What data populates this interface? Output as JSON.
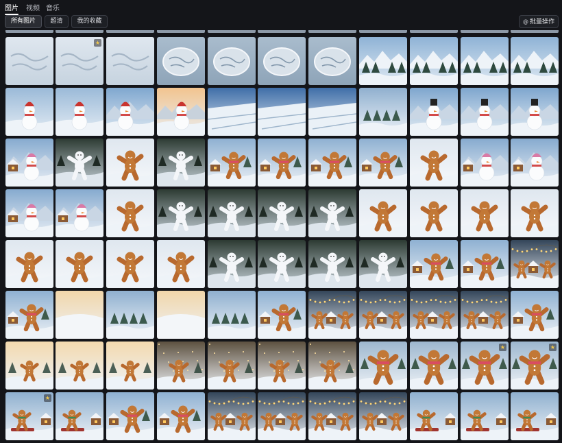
{
  "tabs": [
    {
      "label": "图片",
      "active": true
    },
    {
      "label": "视频",
      "active": false
    },
    {
      "label": "音乐",
      "active": false
    }
  ],
  "filters": [
    {
      "label": "所有图片",
      "selected": true
    },
    {
      "label": "超清",
      "selected": false
    },
    {
      "label": "我的收藏",
      "selected": false
    }
  ],
  "batch_button": {
    "label": "批量操作",
    "icon": "at-sign-icon"
  },
  "grid": {
    "rows": [
      [
        "text-snow",
        "text-snow-fav",
        "text-snow",
        "text-card",
        "text-card",
        "text-card",
        "text-card",
        "mountains",
        "mountains",
        "mountains",
        "mountains"
      ],
      [
        "snowman-small",
        "snowman-small",
        "snowman-red-hat",
        "snowman-lit",
        "field",
        "field",
        "field",
        "snow-trees",
        "snowman-top-hat",
        "snowman-top-hat",
        "snowman-top-hat"
      ],
      [
        "snowman-village",
        "white-figure-dark",
        "gingerbread-white",
        "white-figure-dark",
        "gingerbread-village",
        "gingerbread-village",
        "gingerbread-village",
        "gingerbread-village",
        "gingerbread-white",
        "snowman-village",
        "snowman-village"
      ],
      [
        "snowman-village",
        "snowman-village",
        "gingerbread-white",
        "white-figure-dark",
        "white-figure-dark",
        "white-figure-dark",
        "white-figure-dark",
        "gingerbread-white",
        "gingerbread-white",
        "gingerbread-white",
        "gingerbread-white"
      ],
      [
        "gingerbread-white",
        "gingerbread-white",
        "gingerbread-white",
        "gingerbread-white",
        "white-figure-dark",
        "white-figure-dark",
        "white-figure-dark",
        "white-figure-dark",
        "gingerbread-village",
        "gingerbread-village",
        "gingerbread-lights"
      ],
      [
        "gingerbread-village",
        "snow-hills",
        "snow-trees",
        "snow-hills",
        "snow-trees",
        "gingerbread-village",
        "gingerbread-lights",
        "gingerbread-lights",
        "gingerbread-lights",
        "gingerbread-lights",
        "gingerbread-village"
      ],
      [
        "gingerbread-meadow",
        "gingerbread-meadow",
        "gingerbread-meadow",
        "gingerbread-sparkle",
        "gingerbread-sparkle",
        "gingerbread-sparkle",
        "gingerbread-sparkle",
        "gingerbread-big",
        "gingerbread-big",
        "gingerbread-big-fav",
        "gingerbread-big-fav"
      ],
      [
        "gingerbread-sled-fav",
        "gingerbread-sled",
        "gingerbread-village",
        "gingerbread-village",
        "gingerbread-lights",
        "gingerbread-lights",
        "gingerbread-lights",
        "gingerbread-lights",
        "gingerbread-sled",
        "gingerbread-sled",
        "gingerbread-sled"
      ]
    ],
    "favorite_icon": "star-icon"
  }
}
